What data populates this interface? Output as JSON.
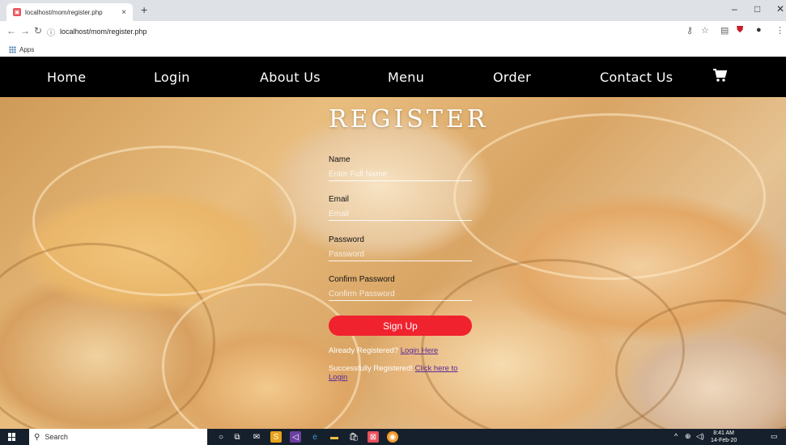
{
  "browser": {
    "tab_title": "localhost/mom/register.php",
    "tab_close": "×",
    "new_tab": "+",
    "url": "localhost/mom/register.php",
    "bookmarks_apps": "Apps",
    "window_minimize": "–",
    "window_maximize": "□",
    "window_close": "✕"
  },
  "nav": {
    "items": [
      "Home",
      "Login",
      "About Us",
      "Menu",
      "Order",
      "Contact Us"
    ]
  },
  "register": {
    "title": "REGISTER",
    "name_label": "Name",
    "name_placeholder": "Enter Full Name",
    "email_label": "Email",
    "email_placeholder": "Email",
    "password_label": "Password",
    "password_placeholder": "Password",
    "confirm_label": "Confirm Password",
    "confirm_placeholder": "Confirm Password",
    "signup_label": "Sign Up",
    "already_text": "Already Registered?",
    "login_here": "Login Here",
    "success_text": "Successfully Registered!",
    "click_here": "Click here to",
    "login_link": "Login"
  },
  "taskbar": {
    "search_label": "Search",
    "time": "8:41 AM",
    "date": "14-Feb-20"
  },
  "colors": {
    "nav_bg": "#000000",
    "signup_bg": "#f0222e",
    "link": "#5a2a9a"
  }
}
